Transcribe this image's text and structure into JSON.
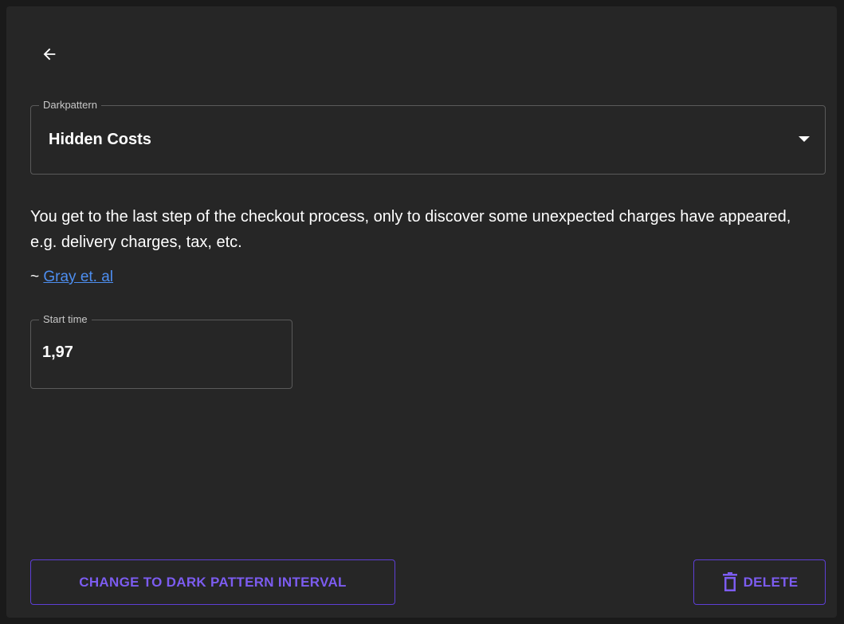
{
  "header": {
    "back_icon": "arrow-left-icon"
  },
  "darkpattern_select": {
    "label": "Darkpattern",
    "value": "Hidden Costs",
    "arrow_icon": "caret-down-icon"
  },
  "description": {
    "text": "You get to the last step of the checkout process, only to discover some unexpected charges have appeared, e.g. delivery charges, tax, etc.",
    "citation_prefix": "~ ",
    "citation_link": "Gray et. al"
  },
  "start_time": {
    "label": "Start time",
    "value": "1,97"
  },
  "actions": {
    "change_label": "CHANGE TO DARK PATTERN INTERVAL",
    "delete_label": "DELETE",
    "delete_icon": "trash-icon"
  },
  "colors": {
    "background": "#1a1a1a",
    "card": "#262626",
    "accent": "#7c5cf0",
    "link": "#4d8ef0"
  }
}
